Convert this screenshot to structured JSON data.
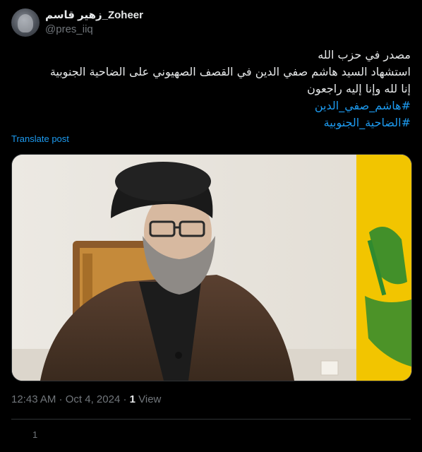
{
  "author": {
    "display_name": "زهير قاسم_Zoheer",
    "handle": "@pres_iiq"
  },
  "tweet": {
    "lines": [
      "مصدر في حزب الله",
      "استشهاد السيد هاشم صفي الدين في القصف الصهيوني على الضاحية الجنوبية",
      "إنا لله وإنا إليه راجعون"
    ],
    "hashtags": [
      "#هاشم_صفي_الدين",
      "#الضاحية_الجنوبية"
    ],
    "translate_label": "Translate post"
  },
  "media": {
    "alt_icon": "photo-of-cleric-with-yellow-flag",
    "colors": {
      "wall": "#ebe8e2",
      "flag_yellow": "#f2c500",
      "flag_green": "#2f8a2f",
      "robe": "#4a3424",
      "turban": "#1a1a1a"
    }
  },
  "meta": {
    "time": "12:43 AM",
    "separator1": " · ",
    "date": "Oct 4, 2024",
    "separator2": " · ",
    "views_count": "1",
    "views_label": " View"
  },
  "actions": {
    "reply_count": "1"
  },
  "colors": {
    "background": "#000000",
    "text": "#e7e9ea",
    "muted": "#71767b",
    "link": "#1d9bf0",
    "border": "#2f3336"
  }
}
